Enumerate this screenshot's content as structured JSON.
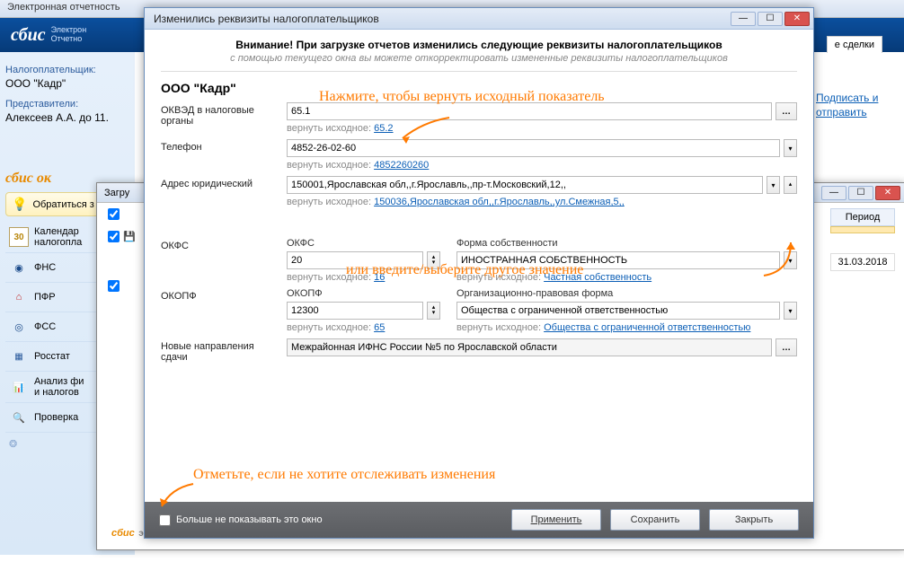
{
  "main": {
    "title": "Электронная отчетность",
    "logo": "сбис",
    "logo_sub": "Электрон\nОтчетно"
  },
  "sidebar": {
    "taxpayer_label": "Налогоплательщик:",
    "taxpayer_value": "ООО \"Кадр\"",
    "reps_label": "Представители:",
    "reps_value": "Алексеев А.А. до 11.",
    "logo2": "сбис ок",
    "obratitsa": "Обратиться з",
    "items": [
      "Календар\nналогопла",
      "ФНС",
      "ПФР",
      "ФСС",
      "Росстат",
      "Анализ фи\nи налогов",
      "Проверка"
    ]
  },
  "right": {
    "tab": "е сделки",
    "sign_send": "Подписать и отправить"
  },
  "sec": {
    "title": "Загру",
    "period_head": "Период",
    "period_date": "31.03.2018"
  },
  "dialog": {
    "title": "Изменились реквизиты налогоплательщиков",
    "warning": "Внимание! При загрузке отчетов изменились следующие реквизиты налогоплательщиков",
    "subwarning": "с помощью текущего окна вы можете откорректировать измененные реквизиты налогоплательщиков",
    "org": "ООО \"Кадр\"",
    "okved_label": "ОКВЭД в налоговые органы",
    "okved_value": "65.1",
    "okved_revert": "65.2",
    "phone_label": "Телефон",
    "phone_value": "4852-26-02-60",
    "phone_revert": "4852260260",
    "addr_label": "Адрес юридический",
    "addr_value": "150001,Ярославская обл,,г.Ярославль,,пр-т.Московский,12,,",
    "addr_revert": "150036,Ярославская обл,,г.Ярославль,,ул.Смежная,5,,",
    "okfs_section": "ОКФС",
    "okfs_label": "ОКФС",
    "okfs_value": "20",
    "okfs_revert": "16",
    "ownform_label": "Форма собственности",
    "ownform_value": "ИНОСТРАННАЯ СОБСТВЕННОСТЬ",
    "ownform_revert": "Частная собственность",
    "okopf_section": "ОКОПФ",
    "okopf_label": "ОКОПФ",
    "okopf_value": "12300",
    "okopf_revert": "65",
    "legalform_label": "Организационно-правовая форма",
    "legalform_value": "Общества с ограниченной ответственностью",
    "legalform_revert": "Общества с ограниченной ответственностью",
    "send_label": "Новые направления сдачи",
    "send_value": "Межрайонная ИФНС России №5 по Ярославской области",
    "revert_prefix": "вернуть исходное:",
    "dontshow": "Больше не показывать это окно",
    "btn_apply": "Применить",
    "btn_save": "Сохранить",
    "btn_close": "Закрыть"
  },
  "anno": {
    "top": "Нажмите, чтобы вернуть исходный показатель",
    "mid": "или введите/выберите другое значение",
    "bot": "Отметьте, если не хотите отслеживать изменения"
  }
}
